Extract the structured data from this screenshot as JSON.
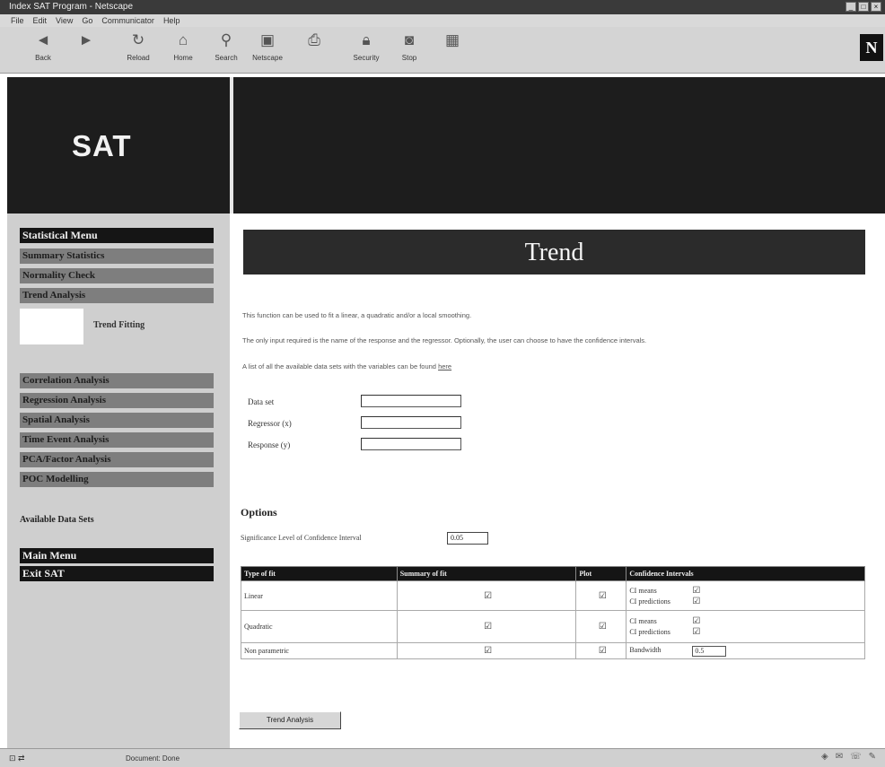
{
  "window": {
    "title": "Index SAT Program - Netscape",
    "menu": [
      "File",
      "Edit",
      "View",
      "Go",
      "Communicator",
      "Help"
    ]
  },
  "toolbar": {
    "buttons": [
      {
        "label": "Back",
        "icon": "back-arrow-icon"
      },
      {
        "label": "",
        "icon": "forward-arrow-icon"
      },
      {
        "label": "Reload",
        "icon": "reload-icon"
      },
      {
        "label": "Home",
        "icon": "home-icon"
      },
      {
        "label": "Search",
        "icon": "search-icon"
      },
      {
        "label": "Netscape",
        "icon": "netscape-guide-icon"
      },
      {
        "label": "",
        "icon": "print-icon"
      },
      {
        "label": "Security",
        "icon": "security-lock-icon"
      },
      {
        "label": "Stop",
        "icon": "stop-icon"
      },
      {
        "label": "",
        "icon": "shop-icon"
      }
    ],
    "brand": "N"
  },
  "banner": {
    "logo": "SAT"
  },
  "sidebar": {
    "items": [
      {
        "label": "Statistical Menu",
        "style": "dark"
      },
      {
        "label": "Summary Statistics",
        "style": "grey"
      },
      {
        "label": "Normality Check",
        "style": "grey"
      },
      {
        "label": "Trend Analysis",
        "style": "grey"
      },
      {
        "label": "Correlation Analysis",
        "style": "grey"
      },
      {
        "label": "Regression Analysis",
        "style": "grey"
      },
      {
        "label": "Spatial Analysis",
        "style": "grey"
      },
      {
        "label": "Time Event Analysis",
        "style": "grey"
      },
      {
        "label": "PCA/Factor Analysis",
        "style": "grey"
      },
      {
        "label": "POC Modelling",
        "style": "grey"
      },
      {
        "label": "Main Menu",
        "style": "dark"
      },
      {
        "label": "Exit SAT",
        "style": "dark"
      }
    ],
    "trend_fitting": "Trend Fitting",
    "available_data_sets": "Available Data Sets"
  },
  "main": {
    "title": "Trend",
    "para1": "This function can be used to fit a linear, a quadratic and/or a local smoothing.",
    "para2": "The only input required is the name of the response and the regressor. Optionally, the user can choose to have the confidence intervals.",
    "para3_text": "A list of all the available data sets with the variables can be found ",
    "para3_link": "here",
    "fields": [
      {
        "label": "Data set",
        "value": ""
      },
      {
        "label": "Regressor (x)",
        "value": ""
      },
      {
        "label": "Response (y)",
        "value": ""
      }
    ],
    "options_title": "Options",
    "significance_label": "Significance Level of Confidence Interval",
    "significance_value": "0.05",
    "table": {
      "headers": [
        "Type of fit",
        "Summary of fit",
        "Plot",
        "Confidence Intervals"
      ],
      "rows": [
        {
          "type": "Linear",
          "ci": [
            {
              "label": "CI means",
              "checked": true
            },
            {
              "label": "CI predictions",
              "checked": true
            }
          ]
        },
        {
          "type": "Quadratic",
          "ci": [
            {
              "label": "CI means",
              "checked": true
            },
            {
              "label": "CI predictions",
              "checked": true
            }
          ]
        },
        {
          "type": "Non parametric",
          "bandwidth_label": "Bandwidth",
          "bandwidth_value": "0.5"
        }
      ]
    },
    "run_button": "Trend Analysis"
  },
  "status": {
    "text": "Document: Done"
  }
}
